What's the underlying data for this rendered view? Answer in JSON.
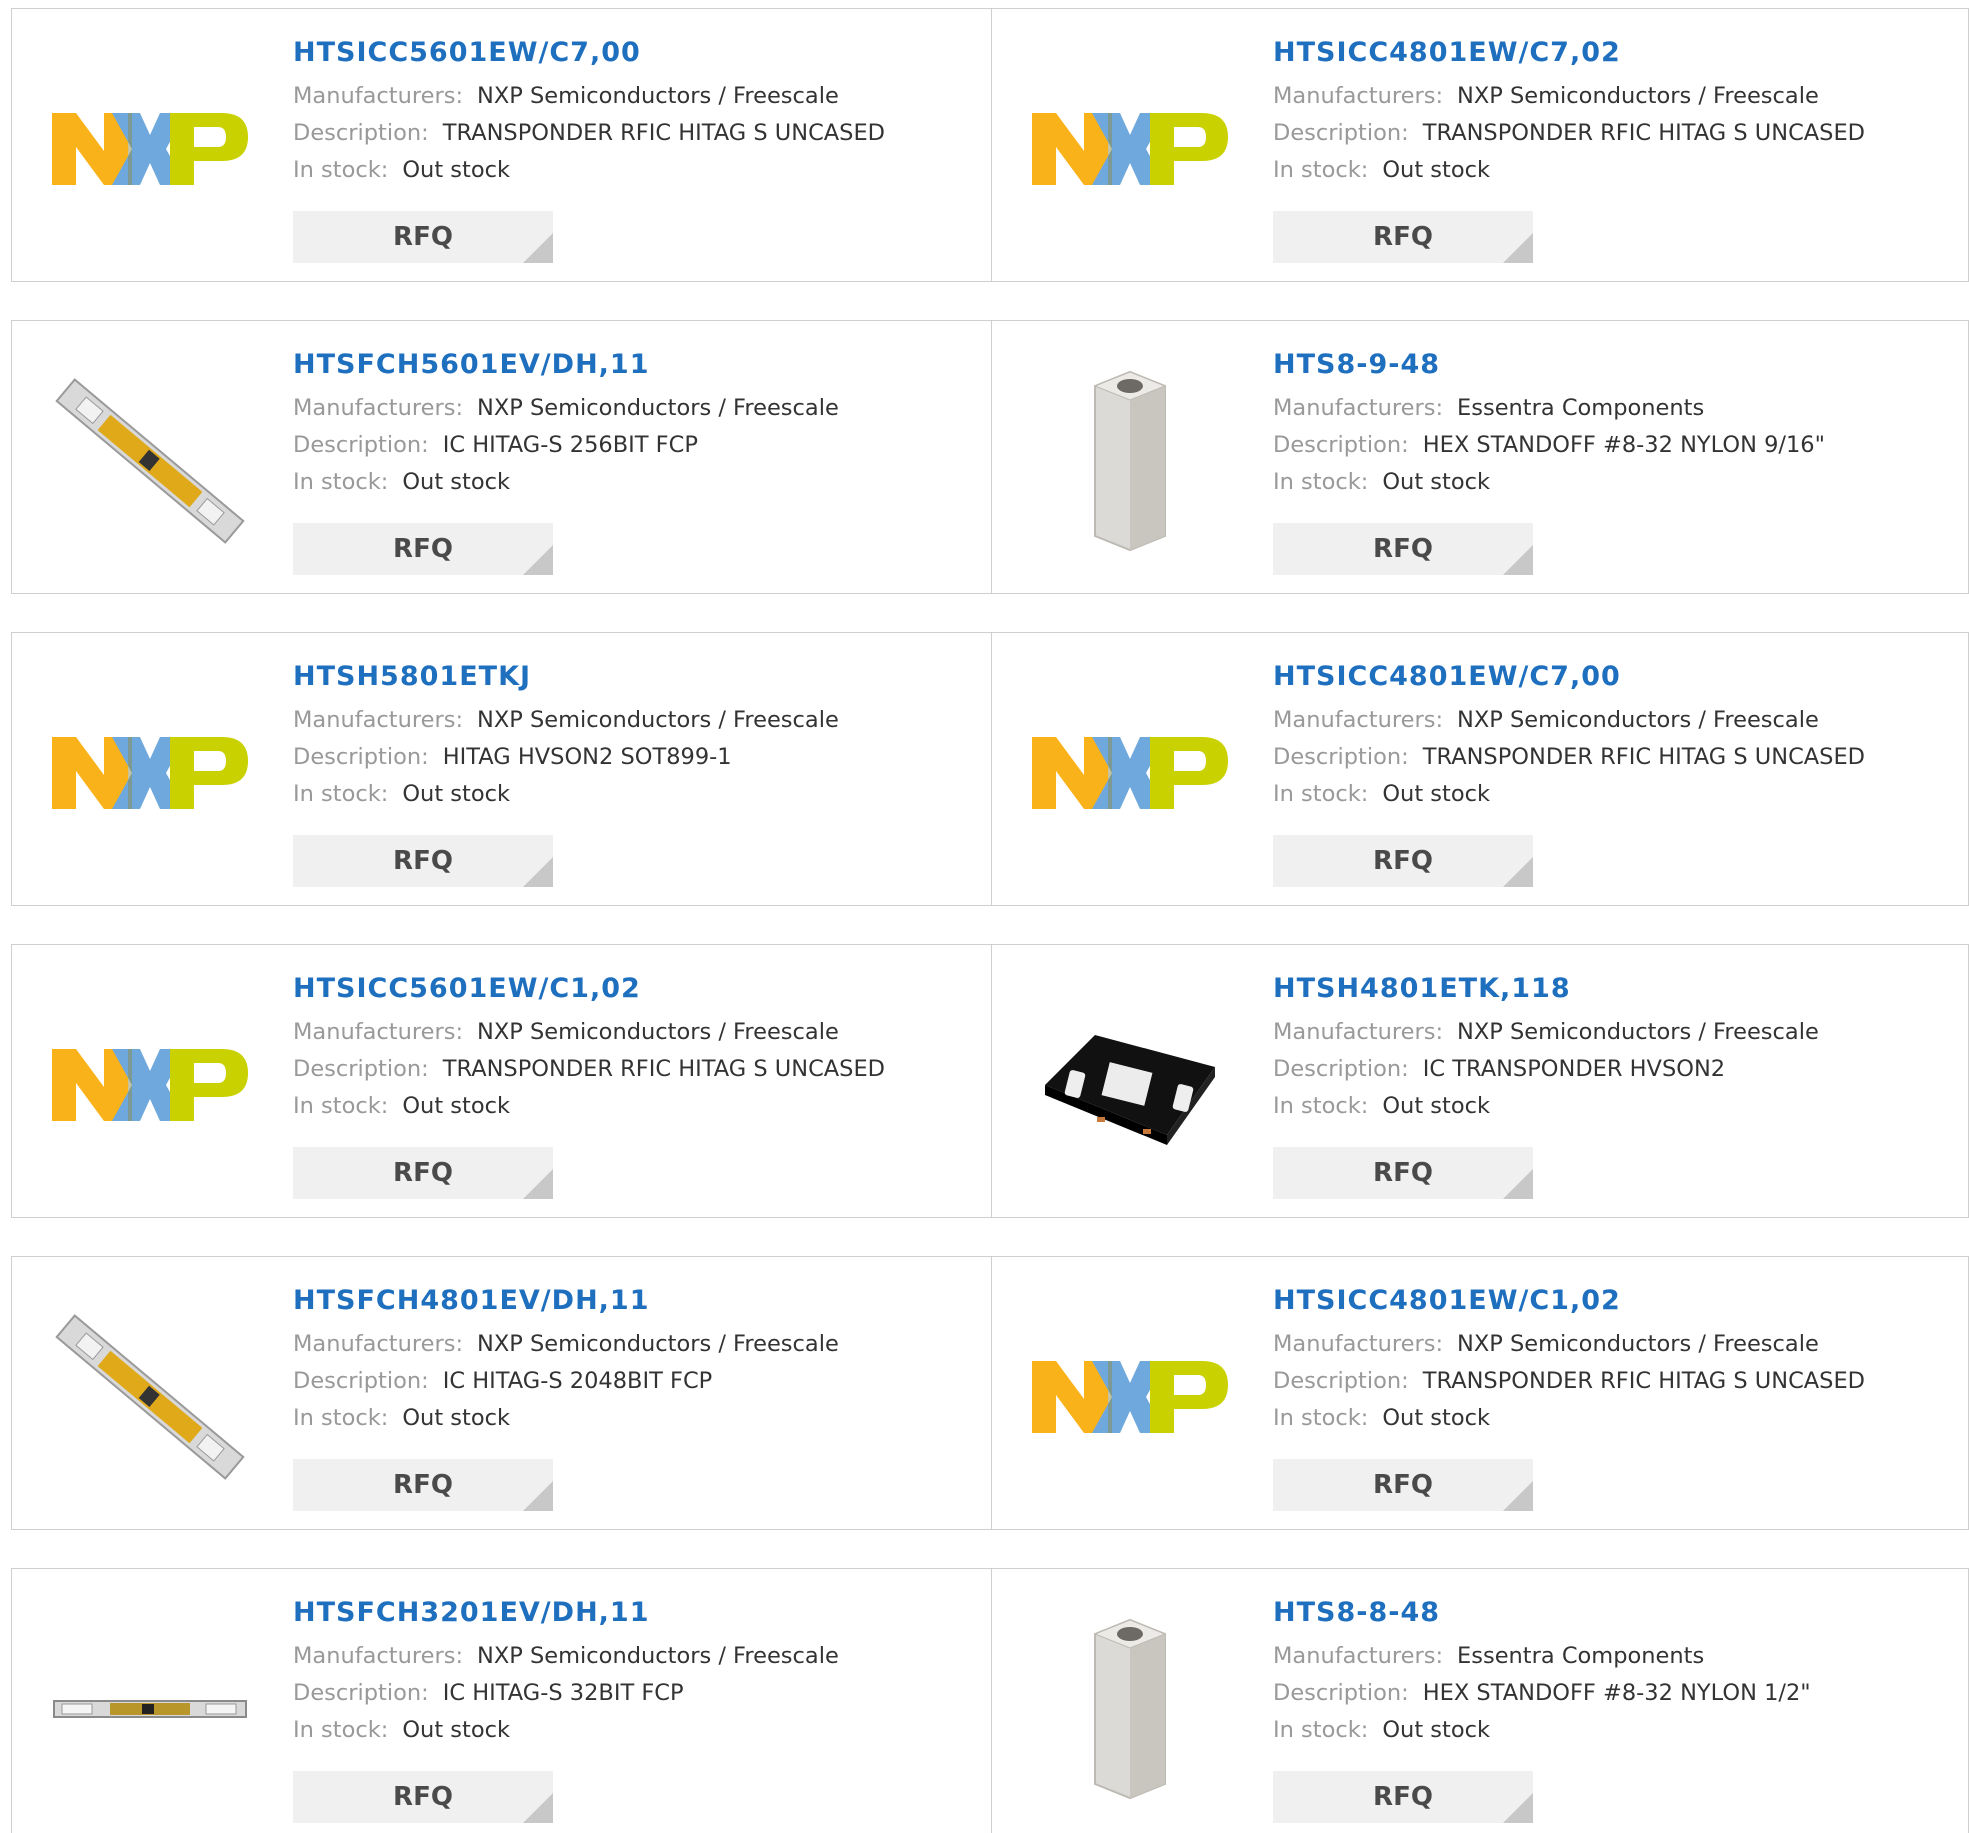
{
  "labels": {
    "manufacturers": "Manufacturers:",
    "description": "Description:",
    "in_stock": "In stock:",
    "rfq": "RFQ"
  },
  "products": [
    {
      "part": "HTSICC5601EW/C7,00",
      "manufacturer": "NXP Semiconductors / Freescale",
      "description": "TRANSPONDER RFIC HITAG S UNCASED",
      "stock": "Out stock",
      "image": "nxp-logo"
    },
    {
      "part": "HTSICC4801EW/C7,02",
      "manufacturer": "NXP Semiconductors / Freescale",
      "description": "TRANSPONDER RFIC HITAG S UNCASED",
      "stock": "Out stock",
      "image": "nxp-logo"
    },
    {
      "part": "HTSFCH5601EV/DH,11",
      "manufacturer": "NXP Semiconductors / Freescale",
      "description": "IC HITAG-S 256BIT FCP",
      "stock": "Out stock",
      "image": "tag-strip"
    },
    {
      "part": "HTS8-9-48",
      "manufacturer": "Essentra Components",
      "description": "HEX STANDOFF #8-32 NYLON 9/16\"",
      "stock": "Out stock",
      "image": "hex-standoff"
    },
    {
      "part": "HTSH5801ETKJ",
      "manufacturer": "NXP Semiconductors / Freescale",
      "description": "HITAG HVSON2 SOT899-1",
      "stock": "Out stock",
      "image": "nxp-logo"
    },
    {
      "part": "HTSICC4801EW/C7,00",
      "manufacturer": "NXP Semiconductors / Freescale",
      "description": "TRANSPONDER RFIC HITAG S UNCASED",
      "stock": "Out stock",
      "image": "nxp-logo"
    },
    {
      "part": "HTSICC5601EW/C1,02",
      "manufacturer": "NXP Semiconductors / Freescale",
      "description": "TRANSPONDER RFIC HITAG S UNCASED",
      "stock": "Out stock",
      "image": "nxp-logo"
    },
    {
      "part": "HTSH4801ETK,118",
      "manufacturer": "NXP Semiconductors / Freescale",
      "description": "IC TRANSPONDER HVSON2",
      "stock": "Out stock",
      "image": "chip-package"
    },
    {
      "part": "HTSFCH4801EV/DH,11",
      "manufacturer": "NXP Semiconductors / Freescale",
      "description": "IC HITAG-S 2048BIT FCP",
      "stock": "Out stock",
      "image": "tag-strip"
    },
    {
      "part": "HTSICC4801EW/C1,02",
      "manufacturer": "NXP Semiconductors / Freescale",
      "description": "TRANSPONDER RFIC HITAG S UNCASED",
      "stock": "Out stock",
      "image": "nxp-logo"
    },
    {
      "part": "HTSFCH3201EV/DH,11",
      "manufacturer": "NXP Semiconductors / Freescale",
      "description": "IC HITAG-S 32BIT FCP",
      "stock": "Out stock",
      "image": "tag-strip-flat"
    },
    {
      "part": "HTS8-8-48",
      "manufacturer": "Essentra Components",
      "description": "HEX STANDOFF #8-32 NYLON 1/2\"",
      "stock": "Out stock",
      "image": "hex-standoff"
    }
  ],
  "colors": {
    "part_link": "#1f6fbf",
    "nxp_orange": "#f9b219",
    "nxp_blue": "#6fa8dc",
    "nxp_green": "#c9d200"
  }
}
